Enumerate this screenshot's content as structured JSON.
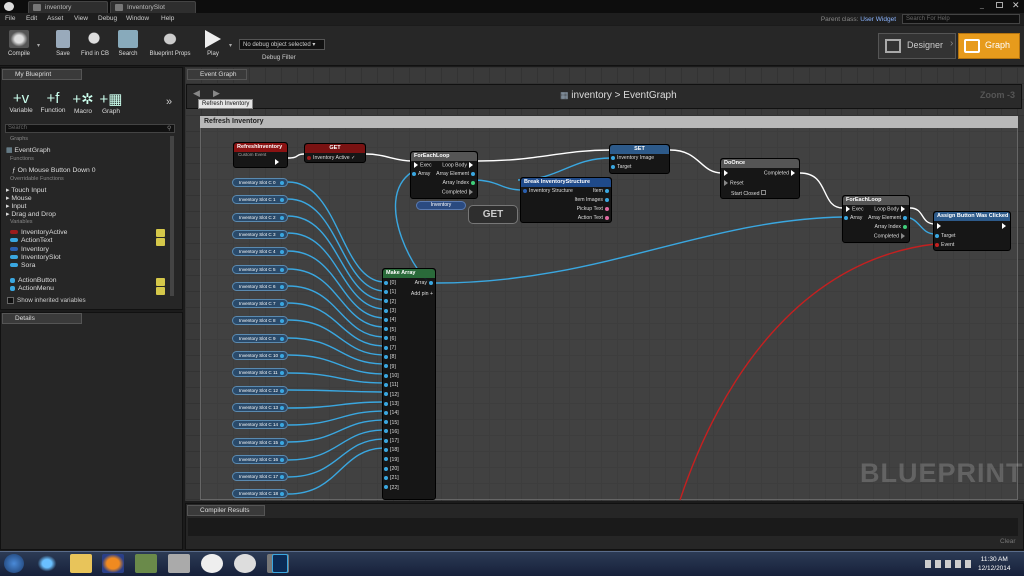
{
  "tabs": [
    {
      "label": "inventory"
    },
    {
      "label": "InventorySlot"
    }
  ],
  "menu": [
    "File",
    "Edit",
    "Asset",
    "View",
    "Debug",
    "Window",
    "Help"
  ],
  "parent_class_label": "Parent class:",
  "parent_class_value": "User Widget",
  "search_help_placeholder": "Search For Help",
  "toolbar": {
    "compile": "Compile",
    "save": "Save",
    "find_in_cb": "Find in CB",
    "search": "Search",
    "blueprint_props": "Blueprint Props",
    "play": "Play",
    "debug_object": "No debug object selected",
    "debug_filter": "Debug Filter"
  },
  "modes": {
    "designer": "Designer",
    "graph": "Graph"
  },
  "my_blueprint": {
    "tab": "My Blueprint",
    "buttons": [
      "Variable",
      "Function",
      "Macro",
      "Graph"
    ],
    "search_placeholder": "Search",
    "graphs_header": "Graphs",
    "event_graph": "EventGraph",
    "functions_header": "Functions",
    "function_item": "On Mouse Button Down 0",
    "overridable": "Overridable Functions",
    "categories": [
      "Touch Input",
      "Mouse",
      "Input",
      "Drag and Drop"
    ],
    "variables_header": "Variables",
    "variables": [
      "InventoryActive",
      "ActionText",
      "Inventory",
      "InventorySlot",
      "Sora"
    ],
    "variables2": [
      "ActionButton",
      "ActionMenu"
    ],
    "show_inherited": "Show inherited variables"
  },
  "details_tab": "Details",
  "event_graph_tab": "Event Graph",
  "breadcrumb": {
    "bp": "inventory",
    "sep": ">",
    "graph": "EventGraph"
  },
  "zoom": "Zoom -3",
  "tooltip": "Refresh Inventory",
  "comment": "Refresh Inventory",
  "nodes": {
    "refresh": {
      "title": "RefreshInventory",
      "sub": "Custom Event"
    },
    "get1": {
      "title": "GET",
      "pin": "Inventory Active"
    },
    "foreach1": {
      "title": "ForEachLoop",
      "exec": "Exec",
      "array": "Array",
      "loop_body": "Loop Body",
      "array_element": "Array Element",
      "array_index": "Array Index",
      "completed": "Completed"
    },
    "inventory_var": "Inventory",
    "get_big": "GET",
    "break": {
      "title": "Break InventoryStructure",
      "in": "Inventory Structure",
      "item": "Item",
      "item_images": "Item Images",
      "pickup_text": "Pickup Text",
      "action_text": "Action Text"
    },
    "get2": {
      "title": "SET",
      "p1": "Inventory Image",
      "p2": "Target"
    },
    "doonce": {
      "title": "DoOnce",
      "reset": "Reset",
      "start_closed": "Start Closed",
      "completed": "Completed"
    },
    "foreach2": {
      "title": "ForEachLoop",
      "exec": "Exec",
      "array": "Array",
      "loop_body": "Loop Body",
      "array_element": "Array Element",
      "array_index": "Array Index",
      "completed": "Completed"
    },
    "assign": {
      "title": "Assign Button Was Clicked",
      "target": "Target",
      "event": "Event"
    },
    "make_array": {
      "title": "Make Array",
      "array": "Array",
      "add_pin": "Add pin",
      "items": [
        "[0]",
        "[1]",
        "[2]",
        "[3]",
        "[4]",
        "[5]",
        "[6]",
        "[7]",
        "[8]",
        "[9]",
        "[10]",
        "[11]",
        "[12]",
        "[13]",
        "[14]",
        "[15]",
        "[16]",
        "[17]",
        "[18]",
        "[19]",
        "[20]",
        "[21]",
        "[22]"
      ]
    }
  },
  "slots": [
    "Inventory Slot C 0",
    "Inventory Slot C 1",
    "Inventory Slot C 2",
    "Inventory Slot C 3",
    "Inventory Slot C 4",
    "Inventory Slot C 5",
    "Inventory Slot C 6",
    "Inventory Slot C 7",
    "Inventory Slot C 8",
    "Inventory Slot C 9",
    "Inventory Slot C 10",
    "Inventory Slot C 11",
    "Inventory Slot C 12",
    "Inventory Slot C 13",
    "Inventory Slot C 14",
    "Inventory Slot C 15",
    "Inventory Slot C 16",
    "Inventory Slot C 17",
    "Inventory Slot C 18"
  ],
  "watermark": "BLUEPRINT",
  "compiler_tab": "Compiler Results",
  "clear": "Clear",
  "clock": {
    "time": "11:30 AM",
    "date": "12/12/2014"
  },
  "colors": {
    "graph_accent": "#e79b1c",
    "pin_blue": "#3aa7e0",
    "event_red": "#a01515"
  }
}
